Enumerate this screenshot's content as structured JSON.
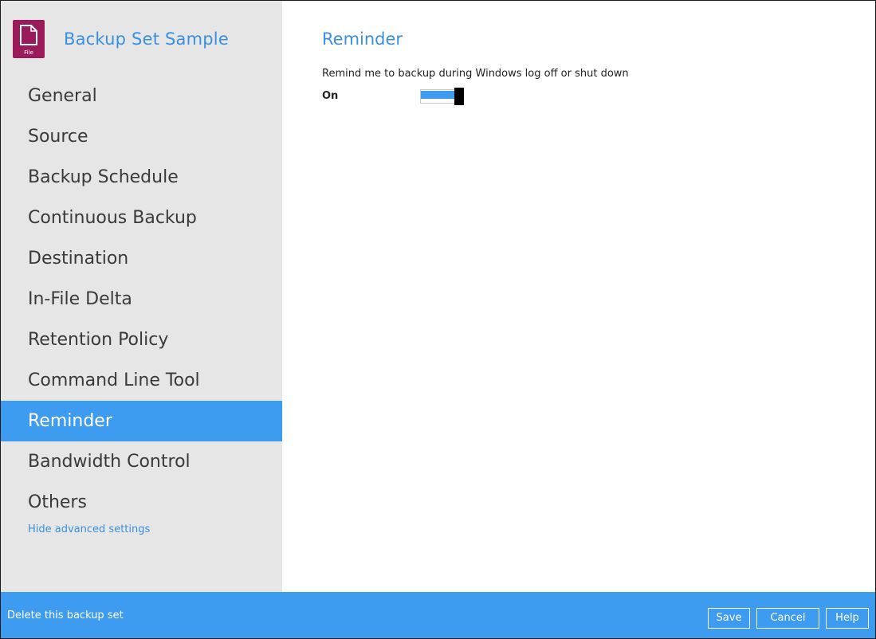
{
  "app": {
    "title": "Backup Set Sample",
    "file_icon_label": "File",
    "icon": "file-icon",
    "brand_color": "#9b1b5a",
    "accent_color": "#3d9bf0"
  },
  "sidebar": {
    "items": [
      {
        "label": "General",
        "active": false
      },
      {
        "label": "Source",
        "active": false
      },
      {
        "label": "Backup Schedule",
        "active": false
      },
      {
        "label": "Continuous Backup",
        "active": false
      },
      {
        "label": "Destination",
        "active": false
      },
      {
        "label": "In-File Delta",
        "active": false
      },
      {
        "label": "Retention Policy",
        "active": false
      },
      {
        "label": "Command Line Tool",
        "active": false
      },
      {
        "label": "Reminder",
        "active": true
      },
      {
        "label": "Bandwidth Control",
        "active": false
      },
      {
        "label": "Others",
        "active": false
      }
    ],
    "advanced_link": "Hide advanced settings"
  },
  "main": {
    "title": "Reminder",
    "description": "Remind me to backup during Windows log off or shut down",
    "state_label": "On",
    "toggle_on": true
  },
  "footer": {
    "delete_label": "Delete this backup set",
    "save_label": "Save",
    "cancel_label": "Cancel",
    "help_label": "Help"
  }
}
